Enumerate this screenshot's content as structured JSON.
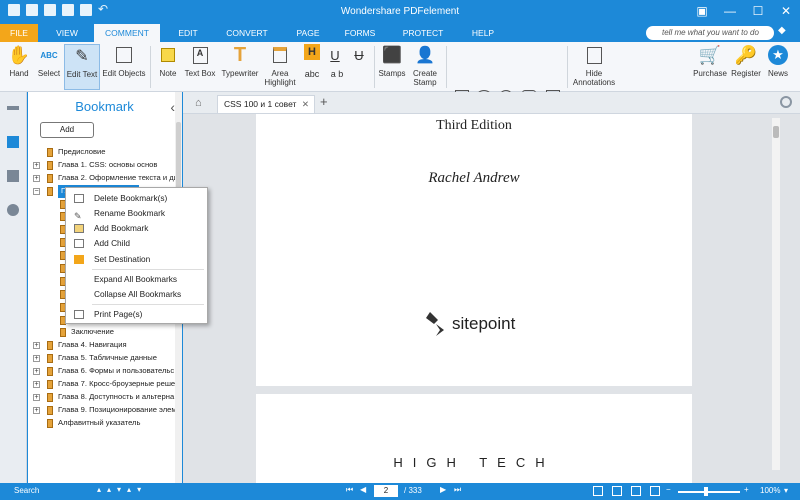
{
  "window": {
    "title": "Wondershare PDFelement"
  },
  "tabs": [
    "FILE",
    "VIEW",
    "COMMENT",
    "EDIT",
    "CONVERT",
    "PAGE",
    "FORMS",
    "PROTECT",
    "HELP"
  ],
  "search": {
    "placeholder": "tell me what you want to do"
  },
  "ribbon": {
    "hand": "Hand",
    "select": "Select",
    "edit_text": "Edit Text",
    "edit_objects": "Edit Objects",
    "note": "Note",
    "text_box": "Text Box",
    "typewriter": "Typewriter",
    "area_highlight": "Area\nHighlight",
    "stamps": "Stamps",
    "create_stamp": "Create\nStamp",
    "hide_annotations": "Hide\nAnnotations",
    "purchase": "Purchase",
    "register": "Register",
    "news": "News",
    "h_label": "H",
    "abc": "abc",
    "ab": "a b"
  },
  "bookmark": {
    "title": "Bookmark",
    "add": "Add",
    "items": [
      {
        "label": "Предисловие",
        "level": 0,
        "expand": false
      },
      {
        "label": "Глава 1.  CSS: основы основ",
        "level": 0,
        "expand": true
      },
      {
        "label": "Глава 2.  Оформление текста и ди",
        "level": 0,
        "expand": true
      },
      {
        "label": "Глава 3.  CSS-макеты",
        "level": 0,
        "expand": true,
        "selected": true
      },
      {
        "label": "",
        "level": 1
      },
      {
        "label": "",
        "level": 1
      },
      {
        "label": "",
        "level": 1
      },
      {
        "label": "",
        "level": 1
      },
      {
        "label": "",
        "level": 1
      },
      {
        "label": "",
        "level": 1
      },
      {
        "label": "",
        "level": 1
      },
      {
        "label": "",
        "level": 1
      },
      {
        "label": "",
        "level": 1
      },
      {
        "label": "Создание сложных рамок вокру",
        "level": 1
      },
      {
        "label": "Заключение",
        "level": 1
      },
      {
        "label": "Глава 4.  Навигация",
        "level": 0,
        "expand": true
      },
      {
        "label": "Глава 5.  Табличные данные",
        "level": 0,
        "expand": true
      },
      {
        "label": "Глава 6.  Формы и пользовательс",
        "level": 0,
        "expand": true
      },
      {
        "label": "Глава 7.  Кросс-броузерные реше",
        "level": 0,
        "expand": true
      },
      {
        "label": "Глава 8.  Доступность и альтерна",
        "level": 0,
        "expand": true
      },
      {
        "label": "Глава 9.  Позиционирование элем",
        "level": 0,
        "expand": true
      },
      {
        "label": "Алфавитный указатель",
        "level": 0,
        "expand": false
      }
    ]
  },
  "context_menu": {
    "delete": "Delete Bookmark(s)",
    "rename": "Rename Bookmark",
    "add": "Add Bookmark",
    "add_child": "Add Child",
    "set_destination": "Set Destination",
    "expand_all": "Expand All Bookmarks",
    "collapse_all": "Collapse All Bookmarks",
    "print": "Print Page(s)"
  },
  "document": {
    "tab": "CSS 100 и 1 совет",
    "edition": "Third Edition",
    "author": "Rachel Andrew",
    "publisher": "sitepoint",
    "page2_heading": "HIGH TECH"
  },
  "status": {
    "search": "Search",
    "page": "2",
    "total": "/ 333",
    "zoom": "100%"
  }
}
